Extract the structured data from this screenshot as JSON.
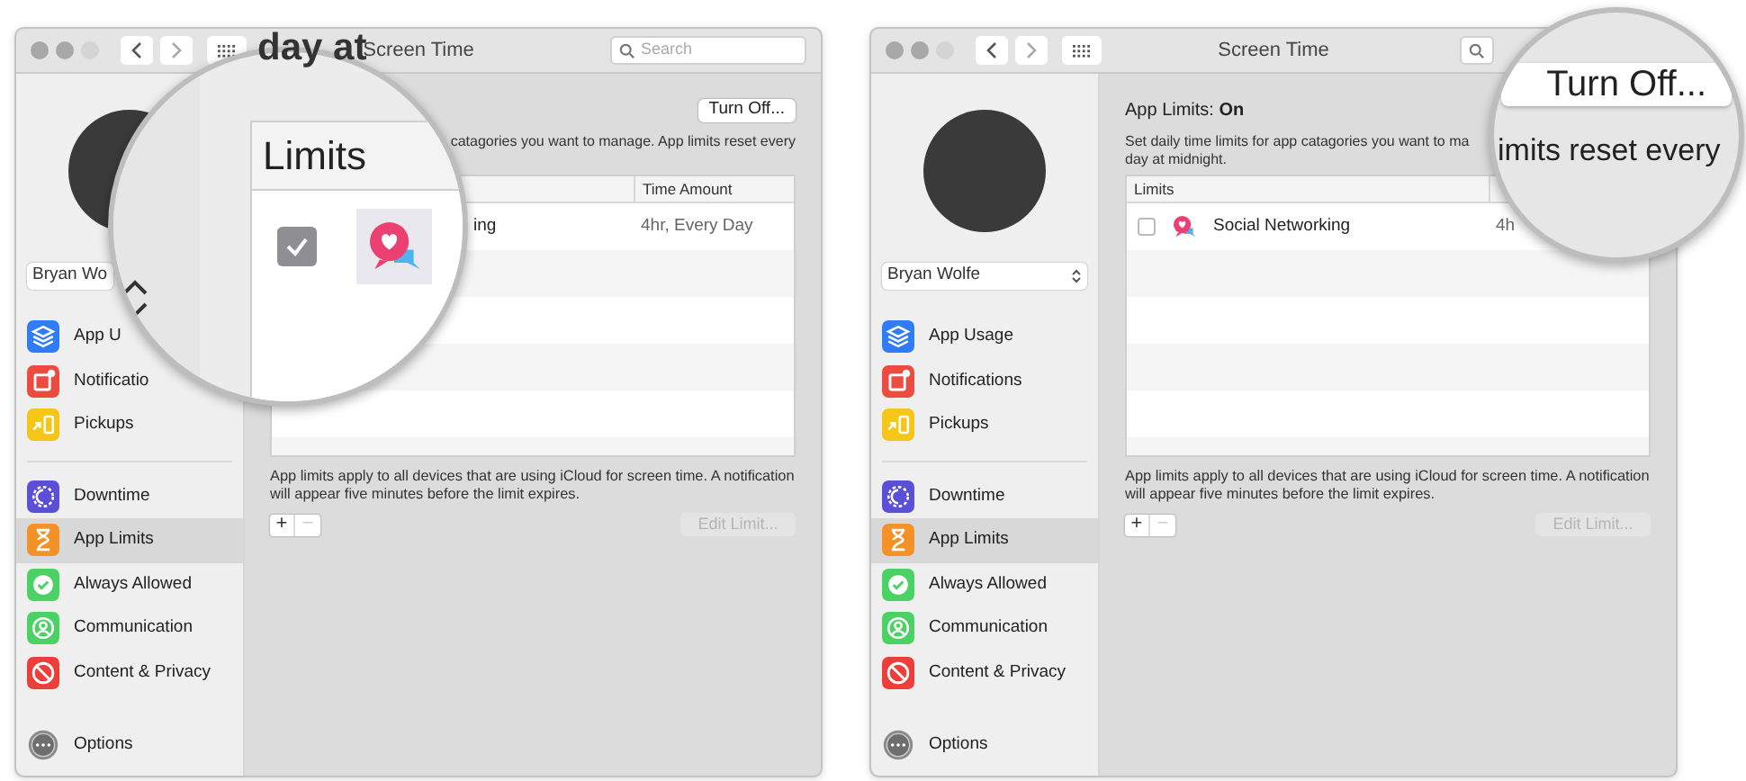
{
  "windows": [
    {
      "title": "Screen Time",
      "search_placeholder": "Search",
      "user_name": "Bryan Wo",
      "stepper": false,
      "sidebar_groups": [
        [
          {
            "kind": "usage",
            "label": "App U",
            "color": "#2f7cf6",
            "selected": false
          },
          {
            "kind": "notifications",
            "label": "Notificatio",
            "color": "#ec4b3f",
            "selected": false
          },
          {
            "kind": "pickups",
            "label": "Pickups",
            "color": "#f5c518",
            "selected": false
          }
        ],
        [
          {
            "kind": "downtime",
            "label": "Downtime",
            "color": "#5b4fd8",
            "selected": false
          },
          {
            "kind": "limits",
            "label": "App Limits",
            "color": "#f4922a",
            "selected": true
          },
          {
            "kind": "allowed",
            "label": "Always Allowed",
            "color": "#4cd264",
            "selected": false
          },
          {
            "kind": "communication",
            "label": "Communication",
            "color": "#4cd264",
            "selected": false
          },
          {
            "kind": "privacy",
            "label": "Content & Privacy",
            "color": "#ee3e3a",
            "selected": false
          }
        ]
      ],
      "options_label": "Options",
      "turn_off_label": "Turn Off...",
      "description_lines": [
        "catagories you want to manage. App limits reset every"
      ],
      "table": {
        "columns": [
          {
            "kind": "time",
            "label": "Time Amount"
          }
        ],
        "rows": [
          {
            "name": "ing",
            "time": "4hr, Every Day"
          }
        ]
      },
      "footnote": "App limits apply to all devices that are using iCloud for screen time. A notification will appear five minutes before the limit expires.",
      "add_label": "+",
      "remove_label": "−",
      "edit_button": {
        "label": "Edit Limit...",
        "disabled": true
      },
      "magnifier": {
        "kind": "limits",
        "spill_text": "day at",
        "header": "Limits",
        "checked": true
      }
    },
    {
      "title": "Screen Time",
      "user_name": "Bryan Wolfe",
      "stepper": true,
      "sidebar_groups": [
        [
          {
            "kind": "usage",
            "label": "App Usage",
            "color": "#2f7cf6",
            "selected": false
          },
          {
            "kind": "notifications",
            "label": "Notifications",
            "color": "#ec4b3f",
            "selected": false
          },
          {
            "kind": "pickups",
            "label": "Pickups",
            "color": "#f5c518",
            "selected": false
          }
        ],
        [
          {
            "kind": "downtime",
            "label": "Downtime",
            "color": "#5b4fd8",
            "selected": false
          },
          {
            "kind": "limits",
            "label": "App Limits",
            "color": "#f4922a",
            "selected": true
          },
          {
            "kind": "allowed",
            "label": "Always Allowed",
            "color": "#4cd264",
            "selected": false
          },
          {
            "kind": "communication",
            "label": "Communication",
            "color": "#4cd264",
            "selected": false
          },
          {
            "kind": "privacy",
            "label": "Content & Privacy",
            "color": "#ee3e3a",
            "selected": false
          }
        ]
      ],
      "options_label": "Options",
      "status_label": "App Limits: ",
      "status_value": "On",
      "description_lines": [
        "Set daily time limits for app catagories you want to ma",
        "day at midnight."
      ],
      "table": {
        "columns": [
          {
            "kind": "name",
            "label": "Limits"
          }
        ],
        "rows": [
          {
            "checked": false,
            "name": "Social Networking",
            "time": "4h"
          }
        ]
      },
      "footnote": "App limits apply to all devices that are using iCloud for screen time. A notification will appear five minutes before the limit expires.",
      "add_label": "+",
      "remove_label": "−",
      "edit_button": {
        "label": "Edit Limit...",
        "disabled": true
      },
      "magnifier": {
        "kind": "turn_off",
        "button": "Turn Off...",
        "text": "imits reset every"
      }
    }
  ]
}
